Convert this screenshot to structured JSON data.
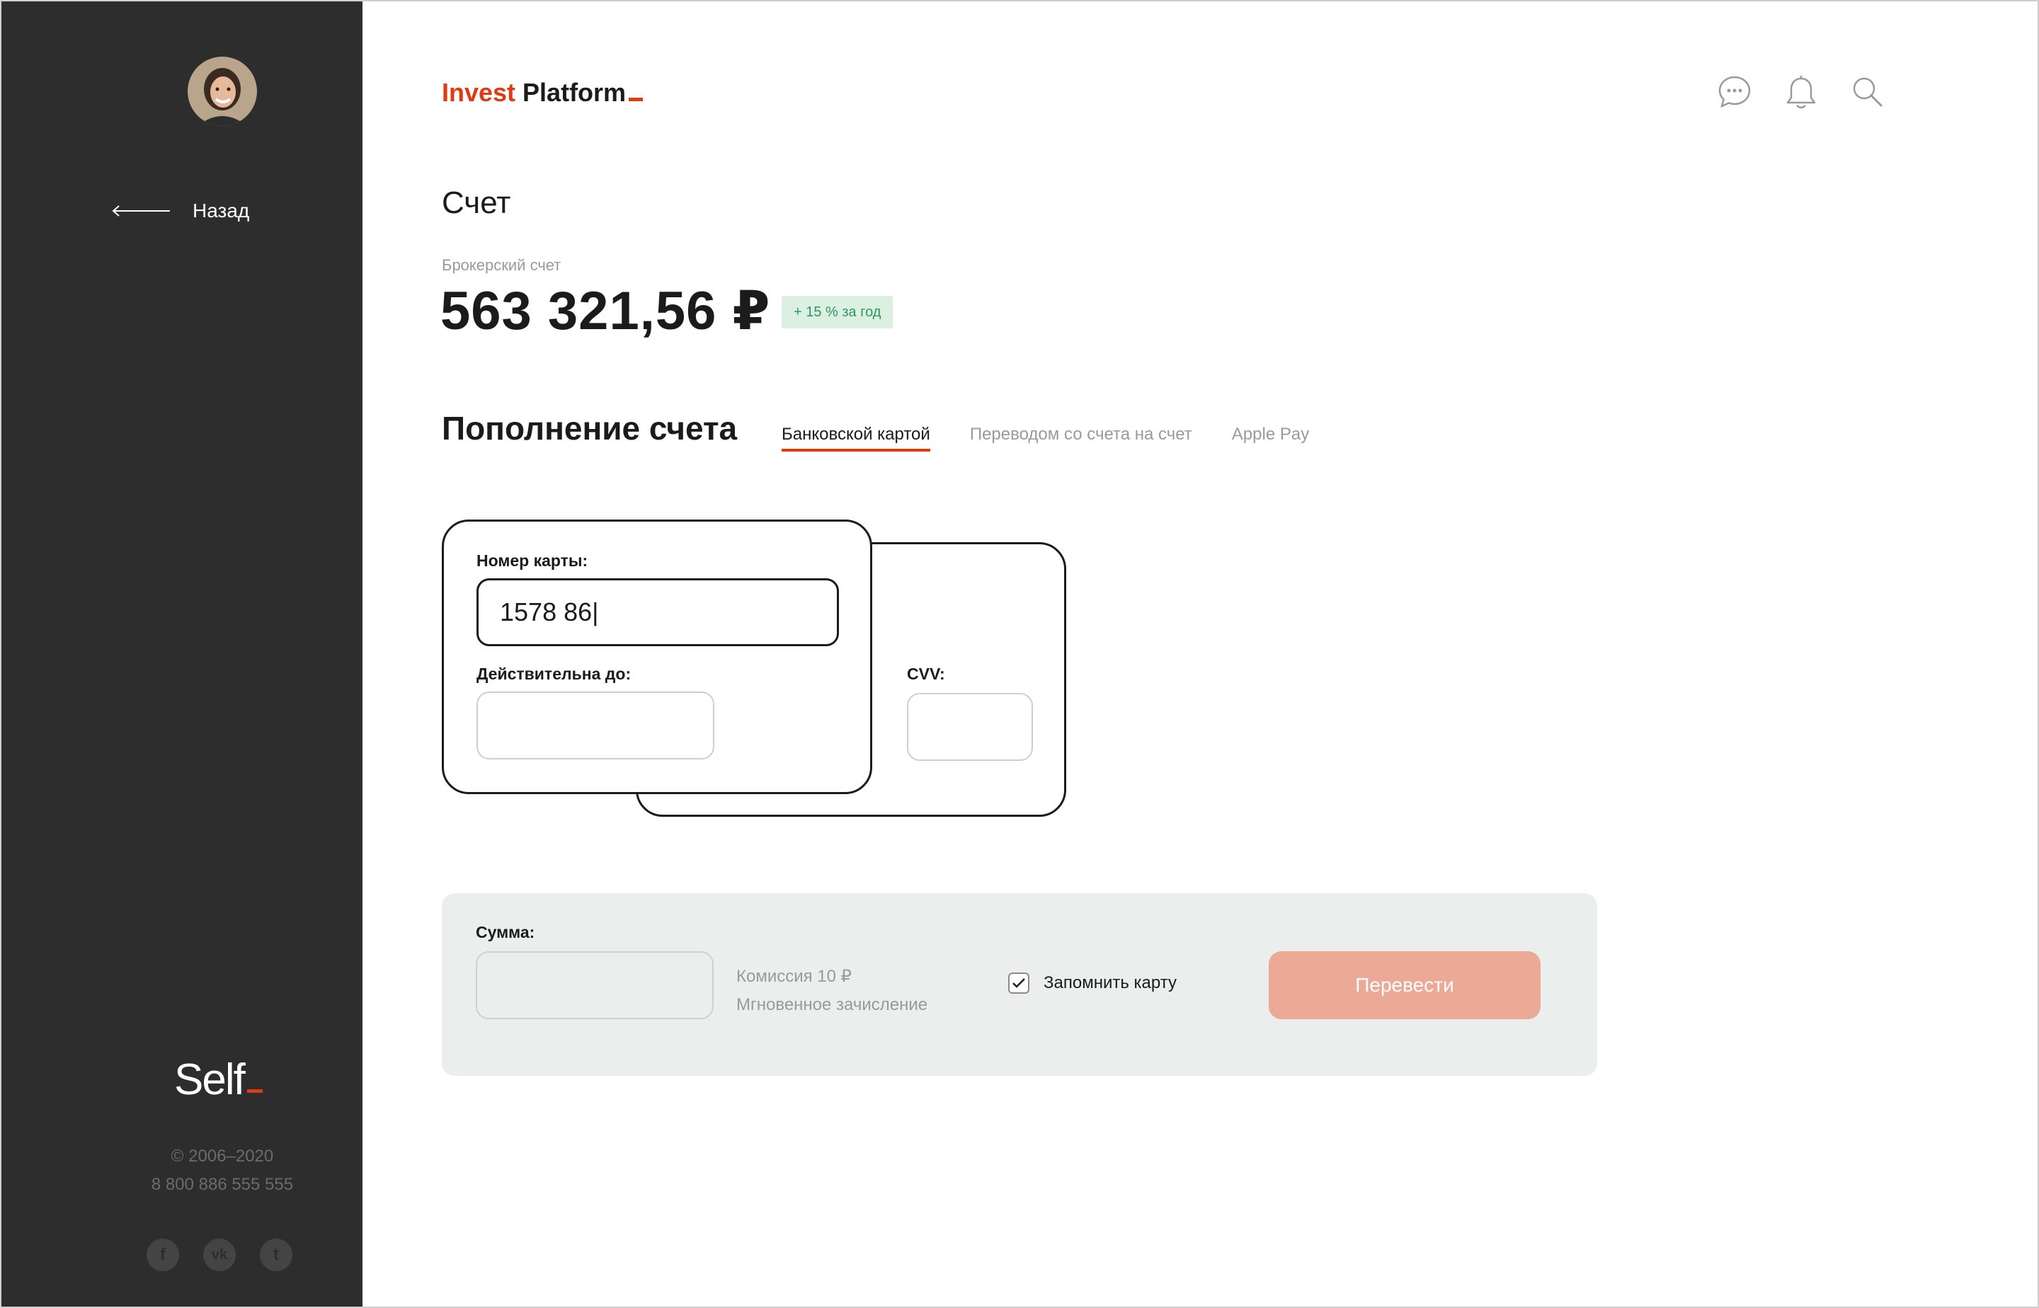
{
  "sidebar": {
    "back_label": "Назад",
    "brand": "Self",
    "copyright": "© 2006–2020",
    "phone": "8 800 886 555 555",
    "socials": [
      {
        "name": "facebook",
        "glyph": "f"
      },
      {
        "name": "vk",
        "glyph": "vk"
      },
      {
        "name": "twitter",
        "glyph": "t"
      }
    ]
  },
  "header": {
    "logo_accent": "Invest",
    "logo_main": "Platform",
    "icons": [
      "chat-icon",
      "bell-icon",
      "search-icon"
    ]
  },
  "account": {
    "title": "Счет",
    "label": "Брокерский счет",
    "balance": "563 321,56 ₽",
    "growth": "+ 15 % за год"
  },
  "replenish": {
    "title": "Пополнение счета",
    "tabs": [
      {
        "label": "Банковской картой",
        "active": true
      },
      {
        "label": "Переводом со счета на счет",
        "active": false
      },
      {
        "label": "Apple Pay",
        "active": false
      }
    ]
  },
  "card": {
    "number_label": "Номер карты:",
    "number_value": "1578 86|",
    "expiry_label": "Действительна до:",
    "expiry_value": "",
    "cvv_label": "CVV:",
    "cvv_value": ""
  },
  "amount": {
    "label": "Сумма:",
    "value": "",
    "commission": "Комиссия 10 ₽",
    "instant": "Мгновенное зачисление",
    "remember_label": "Запомнить карту",
    "remember_checked": true,
    "submit_label": "Перевести"
  },
  "colors": {
    "accent": "#e03a14",
    "sidebar_bg": "#2d2d2d",
    "growth_bg": "#dcefe3",
    "growth_text": "#2e9a57",
    "panel_bg": "#eceeee",
    "submit_bg": "#eca995"
  }
}
